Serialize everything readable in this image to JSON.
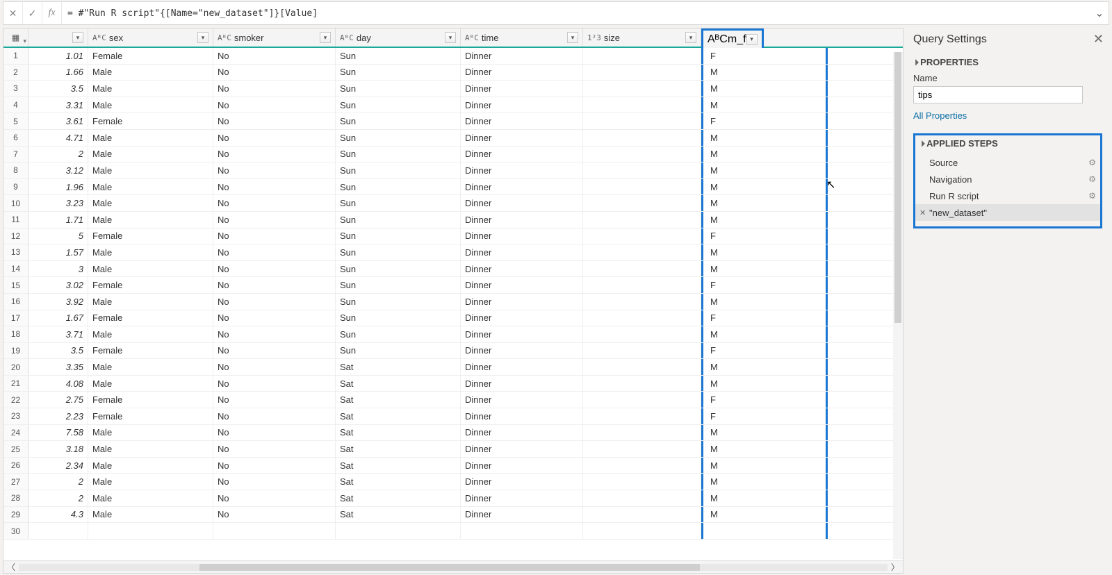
{
  "formula_bar": {
    "value": "= #\"Run R script\"{[Name=\"new_dataset\"]}[Value]"
  },
  "columns": [
    {
      "type": "",
      "label": ""
    },
    {
      "type": "AᴮC",
      "label": "sex"
    },
    {
      "type": "AᴮC",
      "label": "smoker"
    },
    {
      "type": "AᴮC",
      "label": "day"
    },
    {
      "type": "AᴮC",
      "label": "time"
    },
    {
      "type": "1²3",
      "label": "size"
    },
    {
      "type": "AᴮC",
      "label": "m_f"
    }
  ],
  "rows": [
    {
      "n": "1",
      "v": [
        "1.01",
        "Female",
        "No",
        "Sun",
        "Dinner",
        "",
        "F"
      ]
    },
    {
      "n": "2",
      "v": [
        "1.66",
        "Male",
        "No",
        "Sun",
        "Dinner",
        "",
        "M"
      ]
    },
    {
      "n": "3",
      "v": [
        "3.5",
        "Male",
        "No",
        "Sun",
        "Dinner",
        "",
        "M"
      ]
    },
    {
      "n": "4",
      "v": [
        "3.31",
        "Male",
        "No",
        "Sun",
        "Dinner",
        "",
        "M"
      ]
    },
    {
      "n": "5",
      "v": [
        "3.61",
        "Female",
        "No",
        "Sun",
        "Dinner",
        "",
        "F"
      ]
    },
    {
      "n": "6",
      "v": [
        "4.71",
        "Male",
        "No",
        "Sun",
        "Dinner",
        "",
        "M"
      ]
    },
    {
      "n": "7",
      "v": [
        "2",
        "Male",
        "No",
        "Sun",
        "Dinner",
        "",
        "M"
      ]
    },
    {
      "n": "8",
      "v": [
        "3.12",
        "Male",
        "No",
        "Sun",
        "Dinner",
        "",
        "M"
      ]
    },
    {
      "n": "9",
      "v": [
        "1.96",
        "Male",
        "No",
        "Sun",
        "Dinner",
        "",
        "M"
      ]
    },
    {
      "n": "10",
      "v": [
        "3.23",
        "Male",
        "No",
        "Sun",
        "Dinner",
        "",
        "M"
      ]
    },
    {
      "n": "11",
      "v": [
        "1.71",
        "Male",
        "No",
        "Sun",
        "Dinner",
        "",
        "M"
      ]
    },
    {
      "n": "12",
      "v": [
        "5",
        "Female",
        "No",
        "Sun",
        "Dinner",
        "",
        "F"
      ]
    },
    {
      "n": "13",
      "v": [
        "1.57",
        "Male",
        "No",
        "Sun",
        "Dinner",
        "",
        "M"
      ]
    },
    {
      "n": "14",
      "v": [
        "3",
        "Male",
        "No",
        "Sun",
        "Dinner",
        "",
        "M"
      ]
    },
    {
      "n": "15",
      "v": [
        "3.02",
        "Female",
        "No",
        "Sun",
        "Dinner",
        "",
        "F"
      ]
    },
    {
      "n": "16",
      "v": [
        "3.92",
        "Male",
        "No",
        "Sun",
        "Dinner",
        "",
        "M"
      ]
    },
    {
      "n": "17",
      "v": [
        "1.67",
        "Female",
        "No",
        "Sun",
        "Dinner",
        "",
        "F"
      ]
    },
    {
      "n": "18",
      "v": [
        "3.71",
        "Male",
        "No",
        "Sun",
        "Dinner",
        "",
        "M"
      ]
    },
    {
      "n": "19",
      "v": [
        "3.5",
        "Female",
        "No",
        "Sun",
        "Dinner",
        "",
        "F"
      ]
    },
    {
      "n": "20",
      "v": [
        "3.35",
        "Male",
        "No",
        "Sat",
        "Dinner",
        "",
        "M"
      ]
    },
    {
      "n": "21",
      "v": [
        "4.08",
        "Male",
        "No",
        "Sat",
        "Dinner",
        "",
        "M"
      ]
    },
    {
      "n": "22",
      "v": [
        "2.75",
        "Female",
        "No",
        "Sat",
        "Dinner",
        "",
        "F"
      ]
    },
    {
      "n": "23",
      "v": [
        "2.23",
        "Female",
        "No",
        "Sat",
        "Dinner",
        "",
        "F"
      ]
    },
    {
      "n": "24",
      "v": [
        "7.58",
        "Male",
        "No",
        "Sat",
        "Dinner",
        "",
        "M"
      ]
    },
    {
      "n": "25",
      "v": [
        "3.18",
        "Male",
        "No",
        "Sat",
        "Dinner",
        "",
        "M"
      ]
    },
    {
      "n": "26",
      "v": [
        "2.34",
        "Male",
        "No",
        "Sat",
        "Dinner",
        "",
        "M"
      ]
    },
    {
      "n": "27",
      "v": [
        "2",
        "Male",
        "No",
        "Sat",
        "Dinner",
        "",
        "M"
      ]
    },
    {
      "n": "28",
      "v": [
        "2",
        "Male",
        "No",
        "Sat",
        "Dinner",
        "",
        "M"
      ]
    },
    {
      "n": "29",
      "v": [
        "4.3",
        "Male",
        "No",
        "Sat",
        "Dinner",
        "",
        "M"
      ]
    },
    {
      "n": "30",
      "v": [
        "",
        "",
        "",
        "",
        "",
        "",
        ""
      ]
    }
  ],
  "panel": {
    "title": "Query Settings",
    "properties_label": "PROPERTIES",
    "name_label": "Name",
    "name_value": "tips",
    "all_properties": "All Properties",
    "applied_steps_label": "APPLIED STEPS",
    "steps": [
      {
        "label": "Source",
        "gear": true,
        "selected": false
      },
      {
        "label": "Navigation",
        "gear": true,
        "selected": false
      },
      {
        "label": "Run R script",
        "gear": true,
        "selected": false
      },
      {
        "label": "\"new_dataset\"",
        "gear": false,
        "selected": true
      }
    ]
  }
}
